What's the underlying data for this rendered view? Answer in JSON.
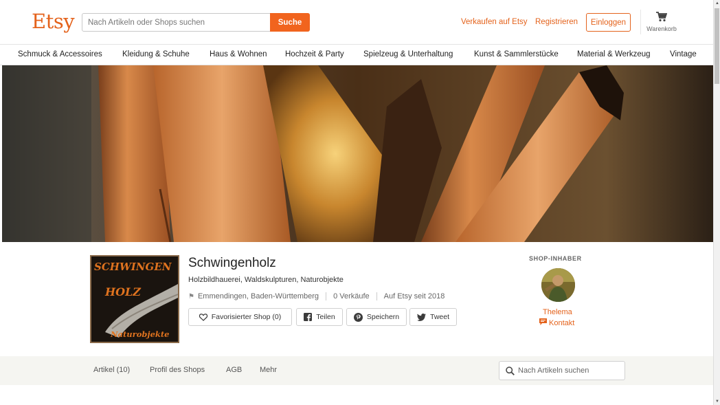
{
  "header": {
    "logo": "Etsy",
    "search": {
      "placeholder": "Nach Artikeln oder Shops suchen",
      "button": "Suche"
    },
    "sell_link": "Verkaufen auf Etsy",
    "register_link": "Registrieren",
    "login_button": "Einloggen",
    "cart_label": "Warenkorb"
  },
  "categories": [
    "Schmuck & Accessoires",
    "Kleidung & Schuhe",
    "Haus & Wohnen",
    "Hochzeit & Party",
    "Spielzeug & Unterhaltung",
    "Kunst & Sammlerstücke",
    "Material & Werkzeug",
    "Vintage"
  ],
  "shop": {
    "logo_text": [
      "SCHWINGEN",
      "HOLZ",
      "Naturobjekte"
    ],
    "name": "Schwingenholz",
    "tagline": "Holzbildhauerei, Waldskulpturen, Naturobjekte",
    "location": "Emmendingen, Baden-Württemberg",
    "sales": "0 Verkäufe",
    "since": "Auf Etsy seit 2018",
    "actions": {
      "favorite": "Favorisierter Shop (0)",
      "share": "Teilen",
      "save": "Speichern",
      "tweet": "Tweet"
    }
  },
  "owner": {
    "title": "SHOP-INHABER",
    "name": "Thelema",
    "contact": "Kontakt"
  },
  "shop_tabs": {
    "items": [
      "Artikel (10)",
      "Profil des Shops",
      "AGB",
      "Mehr"
    ],
    "search_placeholder": "Nach Artikeln suchen"
  },
  "colors": {
    "brand": "#f1641e",
    "link": "#e4621b"
  }
}
